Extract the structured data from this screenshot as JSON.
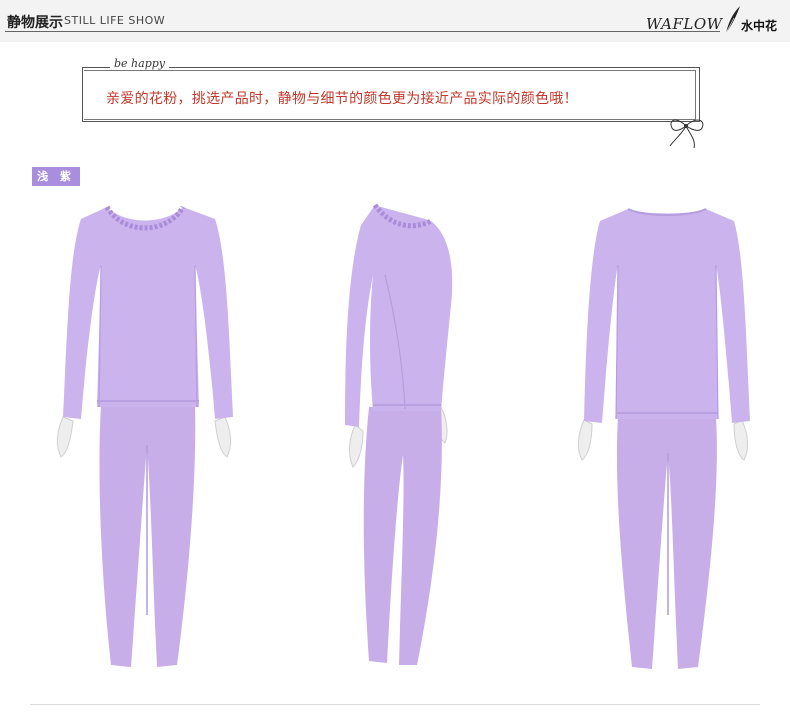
{
  "header": {
    "title_cn": "静物展示",
    "title_en": "STILL LIFE SHOW",
    "brand_en": "WAFLOW",
    "brand_cn": "水中花"
  },
  "note": {
    "script_label": "be happy",
    "text": "亲爱的花粉，挑选产品时，静物与细节的颜色更为接近产品实际的颜色哦！"
  },
  "color_badge": {
    "label": "浅 紫"
  },
  "colors": {
    "garment": "#c8b0ea",
    "garment_shade": "#b59ad9",
    "badge": "#a98ee0",
    "note_text": "#c0392b"
  }
}
